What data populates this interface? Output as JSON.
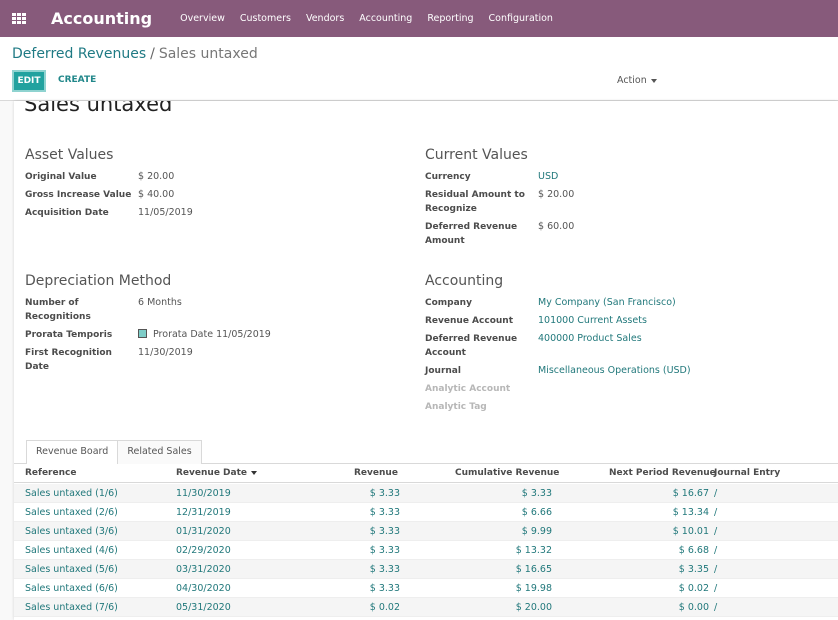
{
  "topbar": {
    "app_title": "Accounting",
    "menu": [
      "Overview",
      "Customers",
      "Vendors",
      "Accounting",
      "Reporting",
      "Configuration"
    ]
  },
  "breadcrumb": {
    "parent": "Deferred Revenues",
    "separator": "/",
    "current": "Sales untaxed"
  },
  "buttons": {
    "edit": "EDIT",
    "create": "CREATE",
    "action": "Action"
  },
  "record": {
    "title": "Sales untaxed",
    "asset_values": {
      "title": "Asset Values",
      "original_value_label": "Original Value",
      "original_value": "$ 20.00",
      "gross_increase_label": "Gross Increase Value",
      "gross_increase": "$ 40.00",
      "acquisition_date_label": "Acquisition Date",
      "acquisition_date": "11/05/2019"
    },
    "current_values": {
      "title": "Current Values",
      "currency_label": "Currency",
      "currency": "USD",
      "residual_label": "Residual Amount to Recognize",
      "residual": "$ 20.00",
      "deferred_label": "Deferred Revenue Amount",
      "deferred": "$ 60.00"
    },
    "depreciation": {
      "title": "Depreciation Method",
      "recognitions_label": "Number of Recognitions",
      "recognitions": "6 Months",
      "prorata_label": "Prorata Temporis",
      "prorata": "Prorata Date 11/05/2019",
      "first_date_label": "First Recognition Date",
      "first_date": "11/30/2019"
    },
    "accounting": {
      "title": "Accounting",
      "company_label": "Company",
      "company": "My Company (San Francisco)",
      "revenue_account_label": "Revenue Account",
      "revenue_account": "101000 Current Assets",
      "deferred_account_label": "Deferred Revenue Account",
      "deferred_account": "400000 Product Sales",
      "journal_label": "Journal",
      "journal": "Miscellaneous Operations (USD)",
      "analytic_account_label": "Analytic Account",
      "analytic_tag_label": "Analytic Tag"
    }
  },
  "tabs": [
    "Revenue Board",
    "Related Sales"
  ],
  "table": {
    "headers": [
      "Reference",
      "Revenue Date",
      "Revenue",
      "Cumulative Revenue",
      "Next Period Revenue",
      "Journal Entry"
    ],
    "rows": [
      [
        "Sales untaxed (1/6)",
        "11/30/2019",
        "$ 3.33",
        "$ 3.33",
        "$ 16.67",
        "/"
      ],
      [
        "Sales untaxed (2/6)",
        "12/31/2019",
        "$ 3.33",
        "$ 6.66",
        "$ 13.34",
        "/"
      ],
      [
        "Sales untaxed (3/6)",
        "01/31/2020",
        "$ 3.33",
        "$ 9.99",
        "$ 10.01",
        "/"
      ],
      [
        "Sales untaxed (4/6)",
        "02/29/2020",
        "$ 3.33",
        "$ 13.32",
        "$ 6.68",
        "/"
      ],
      [
        "Sales untaxed (5/6)",
        "03/31/2020",
        "$ 3.33",
        "$ 16.65",
        "$ 3.35",
        "/"
      ],
      [
        "Sales untaxed (6/6)",
        "04/30/2020",
        "$ 3.33",
        "$ 19.98",
        "$ 0.02",
        "/"
      ],
      [
        "Sales untaxed (7/6)",
        "05/31/2020",
        "$ 0.02",
        "$ 20.00",
        "$ 0.00",
        "/"
      ]
    ]
  },
  "colors": {
    "brand": "#875a7b",
    "primary": "#21a29f",
    "link": "#21787b"
  }
}
